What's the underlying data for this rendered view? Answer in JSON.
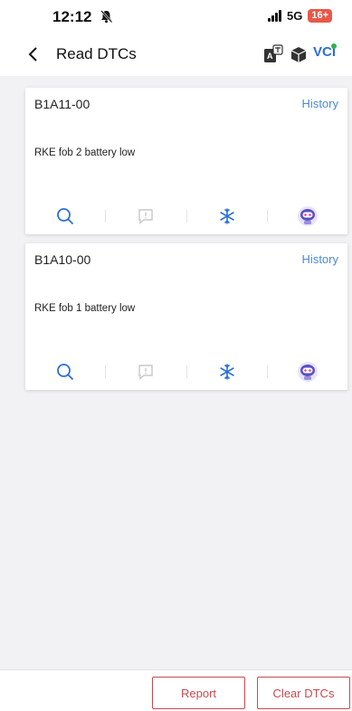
{
  "status_bar": {
    "time": "12:12",
    "network": "5G",
    "battery": "16+"
  },
  "header": {
    "title": "Read DTCs",
    "vci_label": "VCI"
  },
  "dtcs": [
    {
      "code": "B1A11-00",
      "history_label": "History",
      "description": "RKE fob 2 battery low"
    },
    {
      "code": "B1A10-00",
      "history_label": "History",
      "description": "RKE fob 1 battery low"
    }
  ],
  "card_actions": [
    "search-icon",
    "comment-icon",
    "freeze-frame-icon",
    "robot-icon"
  ],
  "footer": {
    "report_label": "Report",
    "clear_label": "Clear DTCs"
  },
  "colors": {
    "accent_blue": "#4a8ad8",
    "button_red": "#c84a50",
    "battery_red": "#e8584a",
    "background": "#f2f2f4"
  }
}
